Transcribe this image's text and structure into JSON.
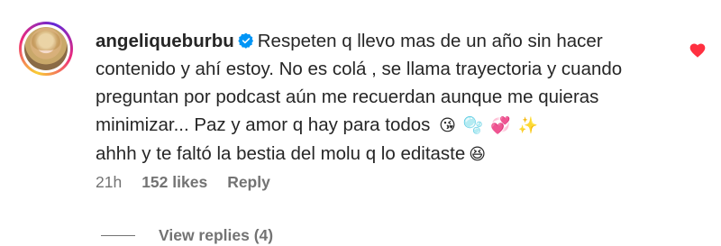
{
  "comment": {
    "username": "angeliqueburbu",
    "verified": true,
    "text_part1": "Respeten q llevo mas de un año sin hacer contenido y ahí estoy. No es colá , se llama trayectoria y cuando preguntan por podcast aún me recuerdan aunque me quieras minimizar... Paz y amor q hay para todos",
    "emoji1": "😘",
    "emoji2": "🫧",
    "emoji3": "💞",
    "emoji4": "✨",
    "text_part2": "ahhh y te faltó la bestia del molu q lo editaste",
    "emoji5": "😆",
    "time": "21h",
    "likes": "152 likes",
    "reply_label": "Reply",
    "view_replies": "View replies (4)",
    "like_icon_color": "#ff3040",
    "verified_color": "#0095f6"
  }
}
